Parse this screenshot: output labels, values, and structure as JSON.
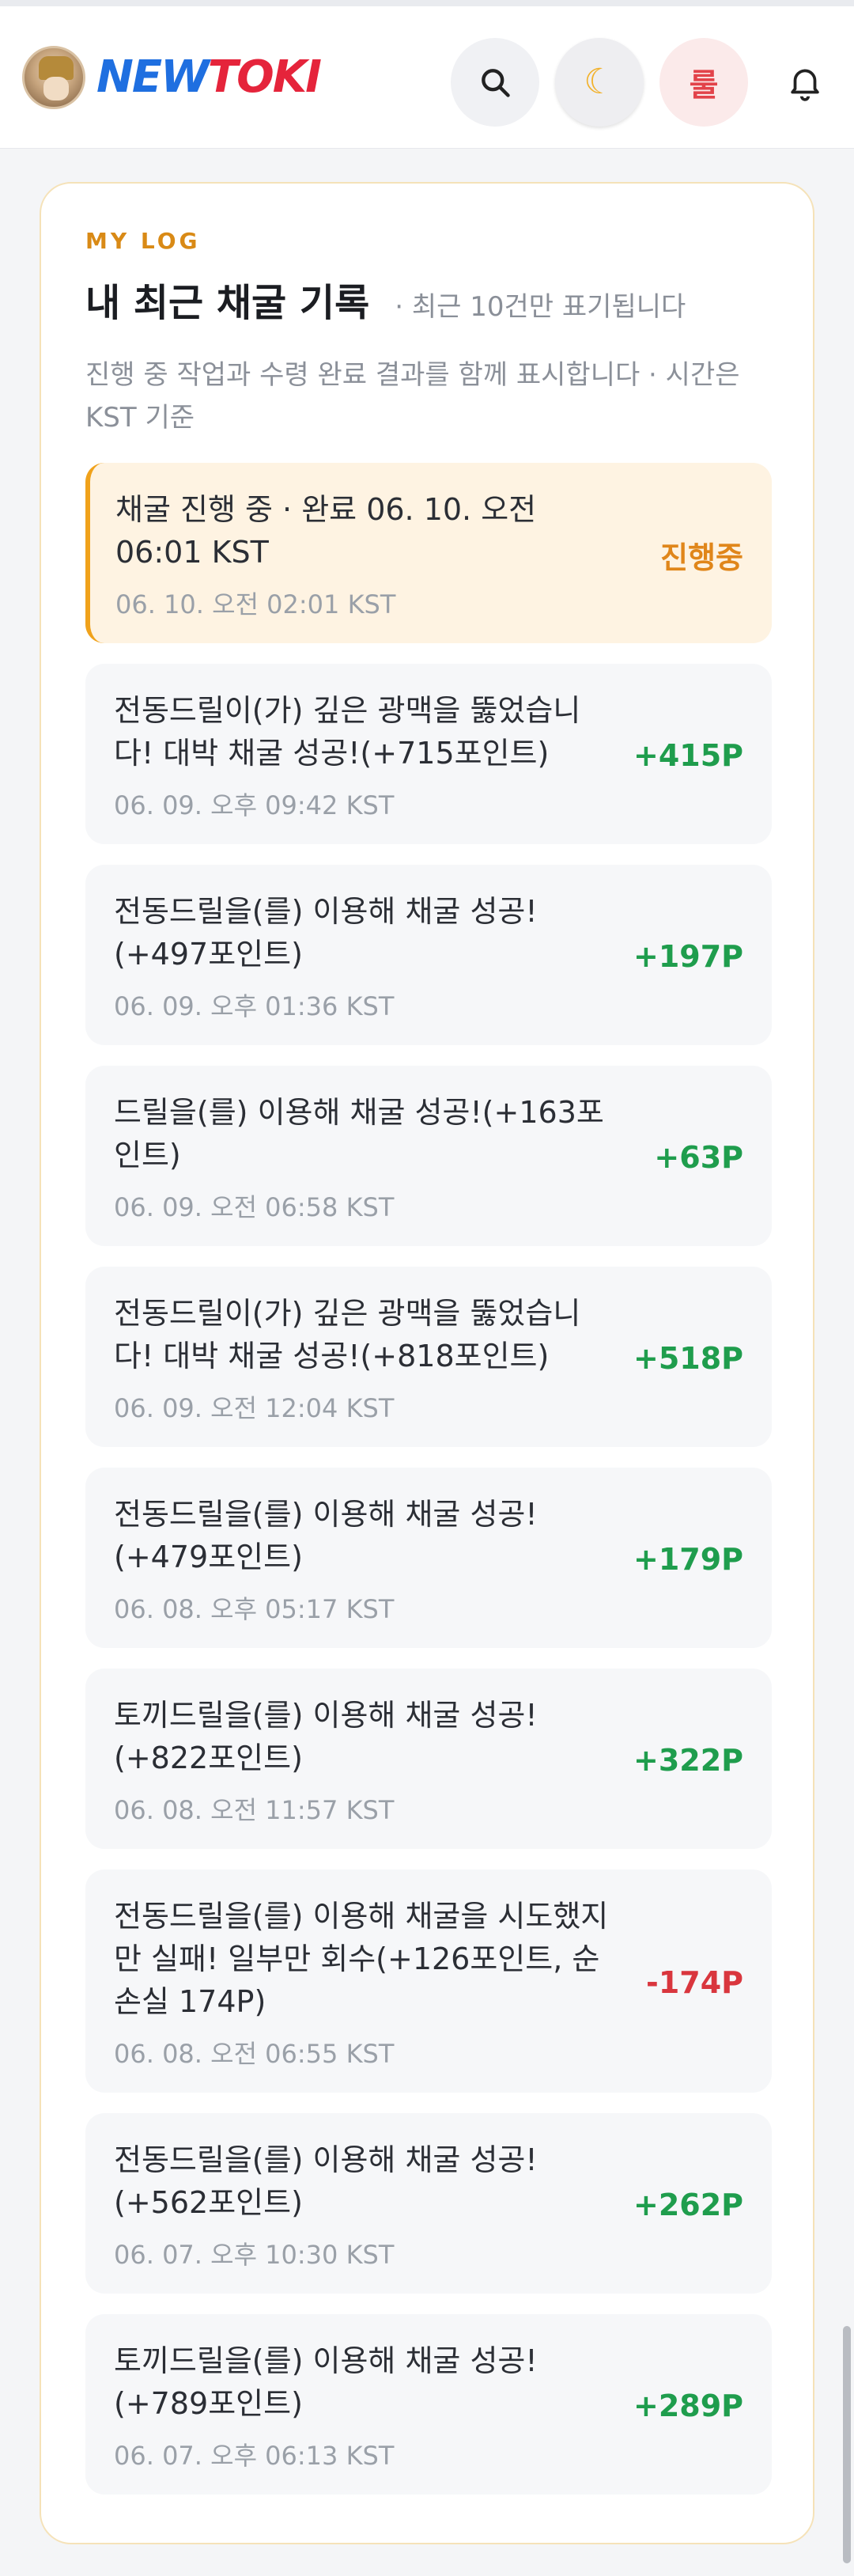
{
  "header": {
    "brand_part1": "NEW",
    "brand_part2": "TOKI",
    "user_label": "룰",
    "icons": [
      "avatar-logo",
      "search-icon",
      "moon-icon",
      "bell-icon"
    ]
  },
  "card": {
    "eyebrow": "MY LOG",
    "title": "내 최근 채굴 기록",
    "title_note": "· 최근 10건만 표기됩니다",
    "description": "진행 중 작업과 수령 완료 결과를 함께 표시합니다 · 시간은 KST 기준"
  },
  "colors": {
    "positive": "#1f9d4d",
    "negative": "#d9363e",
    "in_progress": "#e0861a",
    "accent": "#f0a21b"
  },
  "log": [
    {
      "text": "채굴 진행 중 · 완료 06. 10. 오전 06:01 KST",
      "time": "06. 10. 오전 02:01 KST",
      "amount": "진행중",
      "status": "in_progress"
    },
    {
      "text": "전동드릴이(가) 깊은 광맥을 뚫었습니다! 대박 채굴 성공!(+715포인트)",
      "time": "06. 09. 오후 09:42 KST",
      "amount": "+415P",
      "status": "positive"
    },
    {
      "text": "전동드릴을(를) 이용해 채굴 성공!(+497포인트)",
      "time": "06. 09. 오후 01:36 KST",
      "amount": "+197P",
      "status": "positive"
    },
    {
      "text": "드릴을(를) 이용해 채굴 성공!(+163포인트)",
      "time": "06. 09. 오전 06:58 KST",
      "amount": "+63P",
      "status": "positive"
    },
    {
      "text": "전동드릴이(가) 깊은 광맥을 뚫었습니다! 대박 채굴 성공!(+818포인트)",
      "time": "06. 09. 오전 12:04 KST",
      "amount": "+518P",
      "status": "positive"
    },
    {
      "text": "전동드릴을(를) 이용해 채굴 성공!(+479포인트)",
      "time": "06. 08. 오후 05:17 KST",
      "amount": "+179P",
      "status": "positive"
    },
    {
      "text": "토끼드릴을(를) 이용해 채굴 성공!(+822포인트)",
      "time": "06. 08. 오전 11:57 KST",
      "amount": "+322P",
      "status": "positive"
    },
    {
      "text": "전동드릴을(를) 이용해 채굴을 시도했지만 실패! 일부만 회수(+126포인트, 순손실 174P)",
      "time": "06. 08. 오전 06:55 KST",
      "amount": "-174P",
      "status": "negative"
    },
    {
      "text": "전동드릴을(를) 이용해 채굴 성공!(+562포인트)",
      "time": "06. 07. 오후 10:30 KST",
      "amount": "+262P",
      "status": "positive"
    },
    {
      "text": "토끼드릴을(를) 이용해 채굴 성공!(+789포인트)",
      "time": "06. 07. 오후 06:13 KST",
      "amount": "+289P",
      "status": "positive"
    }
  ]
}
